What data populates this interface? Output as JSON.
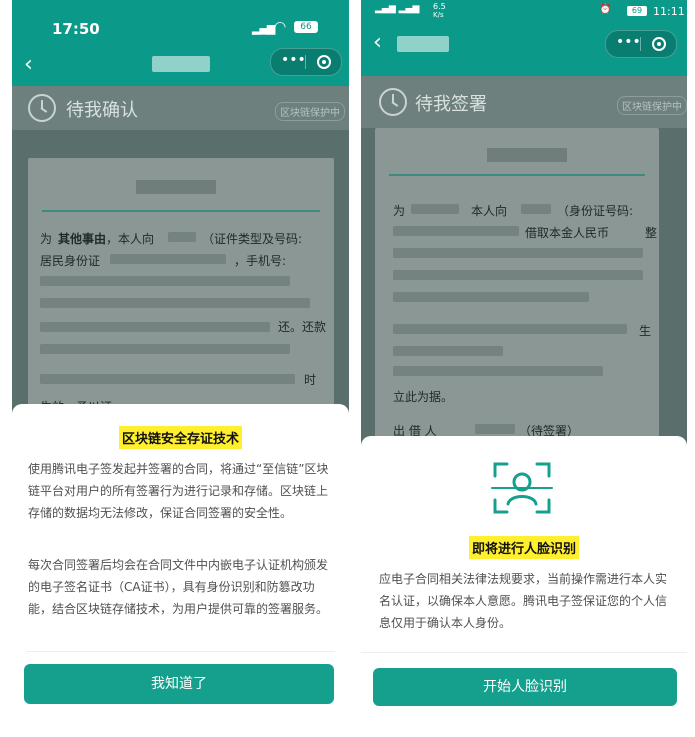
{
  "left": {
    "status": {
      "time": "17:50",
      "battery": "66"
    },
    "doc_header_title": "待我确认",
    "blockchain_badge": "区块链保护中",
    "doc_lines": {
      "l1a": "为",
      "l1b": "其他事由",
      "l1c": "，本人向",
      "l1d": "（证件类型及号码:",
      "l2a": "居民身份证",
      "l2b": "，手机号:",
      "l5": "还。还款",
      "l7": "时",
      "l8": "生效，予以证"
    },
    "sheet": {
      "title": "区块链安全存证技术",
      "para1": "使用腾讯电子签发起并签署的合同，将通过“至信链”区块链平台对用户的所有签署行为进行记录和存储。区块链上存储的数据均无法修改，保证合同签署的安全性。",
      "para2": "每次合同签署后均会在合同文件中内嵌电子认证机构颁发的电子签名证书（CA证书），具有身份识别和防篡改功能，结合区块链存储技术，为用户提供可靠的签署服务。",
      "button": "我知道了"
    }
  },
  "right": {
    "status": {
      "net_speed": "6.5",
      "net_unit": "K/s",
      "battery": "69",
      "time": "11:11"
    },
    "doc_header_title": "待我签署",
    "blockchain_badge": "区块链保护中",
    "doc_lines": {
      "l1a": "为",
      "l1b": "本人向",
      "l1c": "（身份证号码:",
      "l2": "借取本金人民币",
      "l2b": "整",
      "l6": "生",
      "l9": "立此为据。",
      "l10a": "出 借 人",
      "l10b": "（待签署）"
    },
    "sheet": {
      "icon": "face-scan-icon",
      "title": "即将进行人脸识别",
      "para": "应电子合同相关法律法规要求，当前操作需进行本人实名认证，以确保本人意愿。腾讯电子签保证您的个人信息仅用于确认本人身份。",
      "button": "开始人脸识别"
    }
  },
  "colors": {
    "primary": "#0b9a89",
    "button": "#14a08d",
    "highlight": "#ffef2e"
  }
}
